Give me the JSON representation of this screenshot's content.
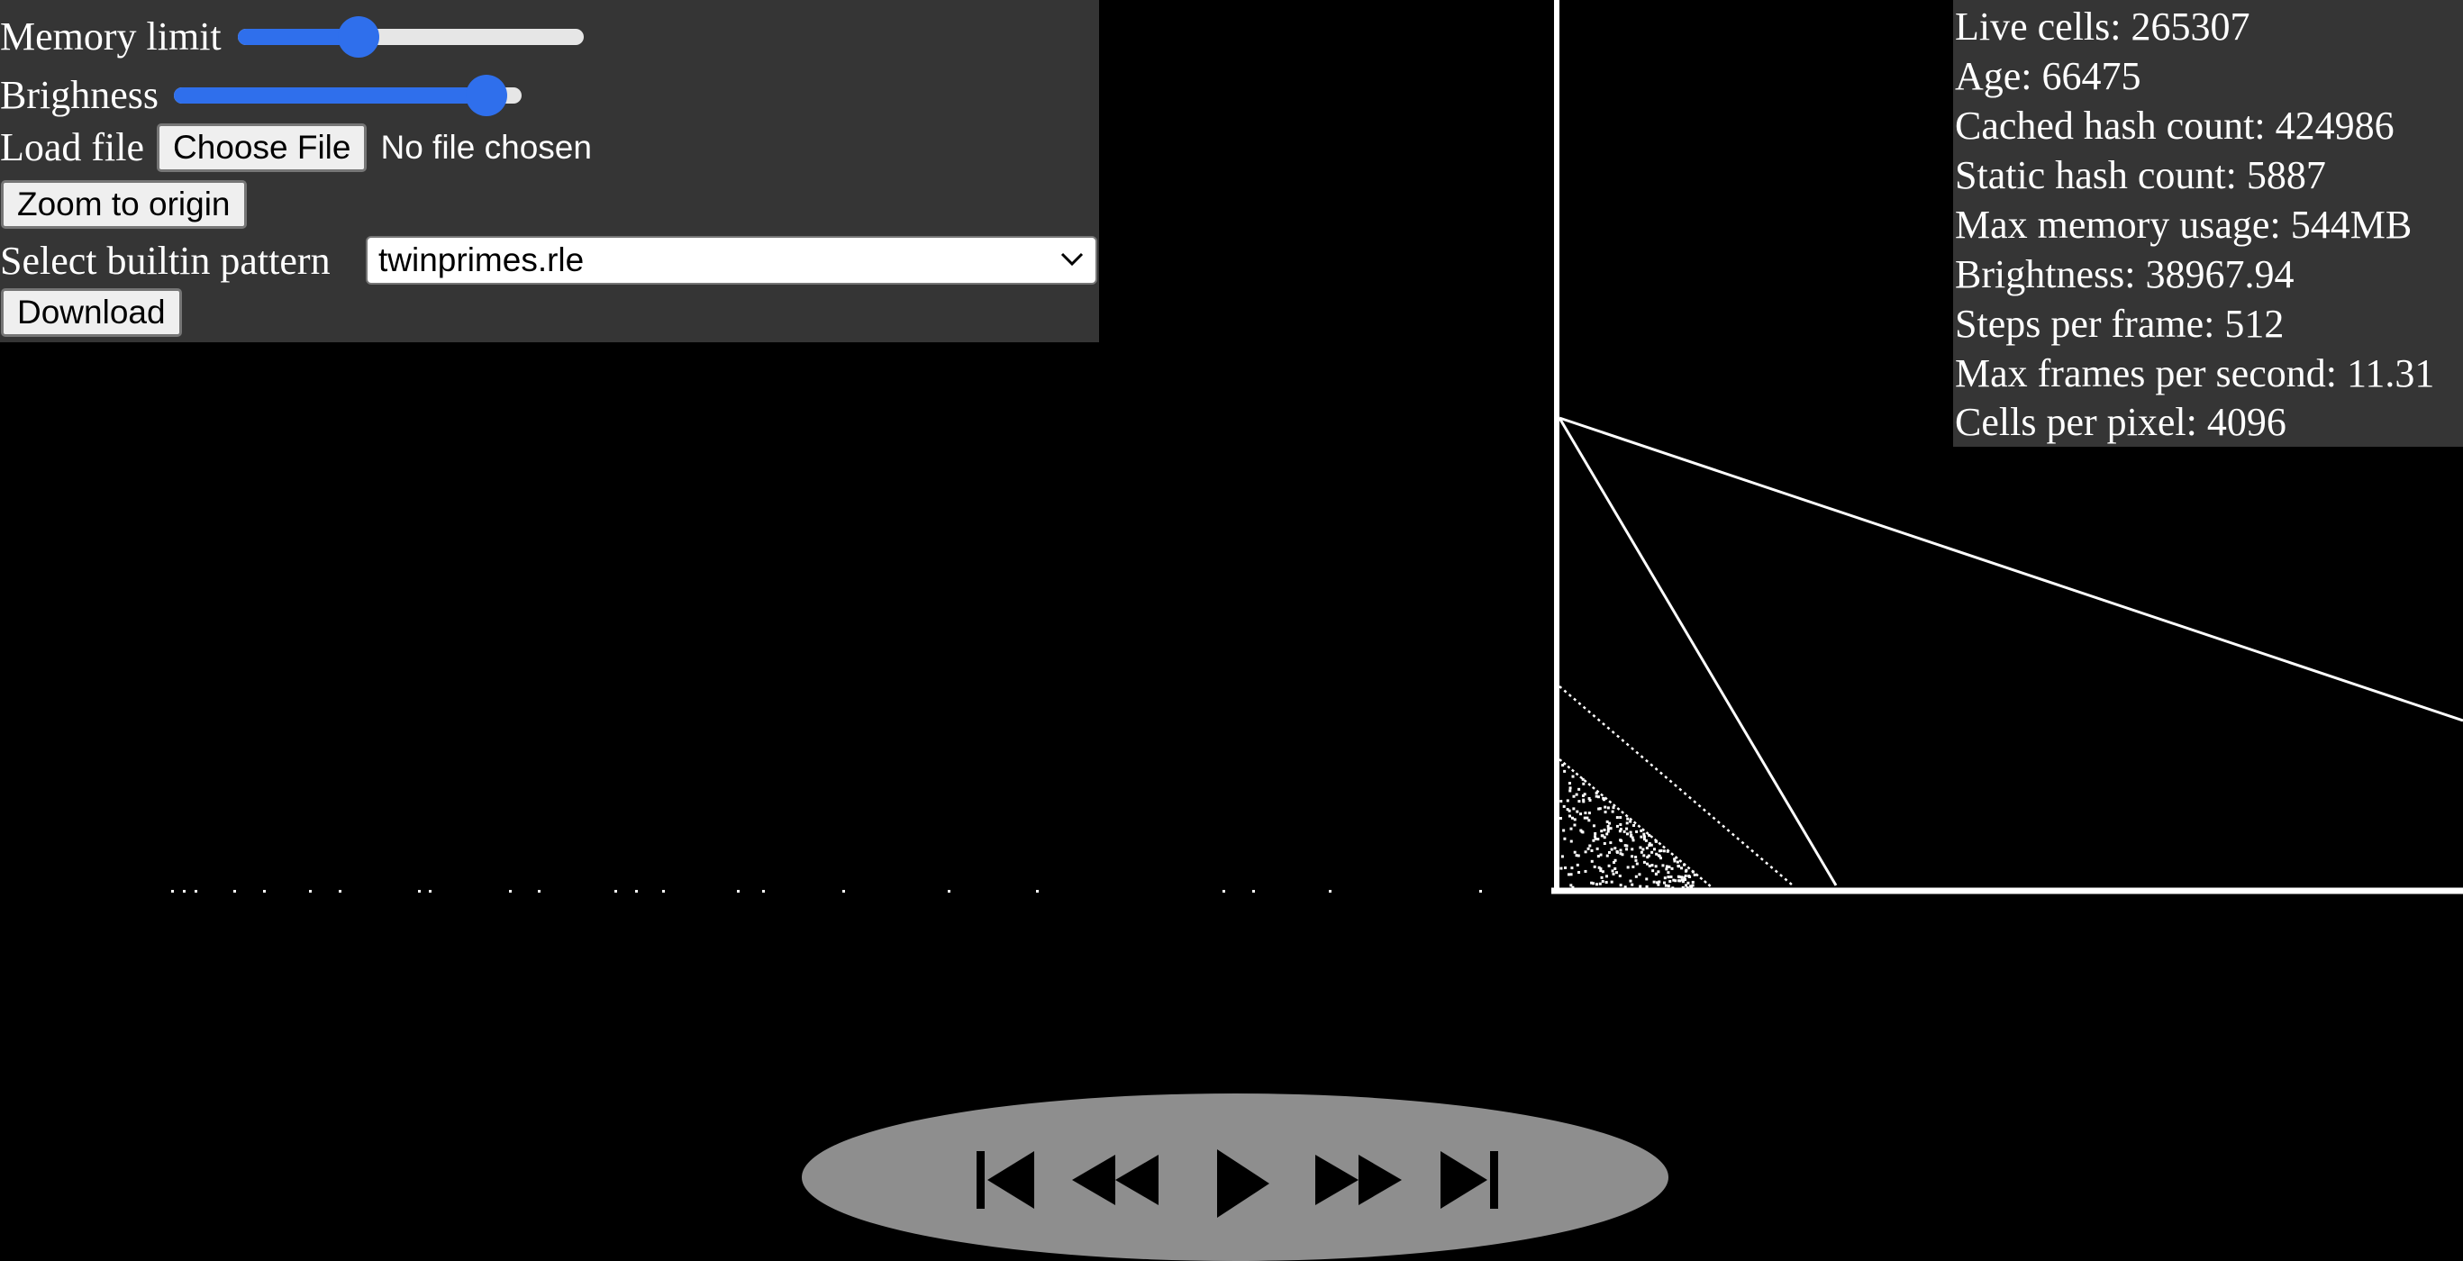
{
  "controls": {
    "memory_limit_label": "Memory limit",
    "memory_limit_value": 0.35,
    "brightness_label": "Brighness",
    "brightness_value": 0.9,
    "load_file_label": "Load file",
    "choose_file_label": "Choose File",
    "no_file_text": "No file chosen",
    "zoom_to_origin_label": "Zoom to origin",
    "builtin_pattern_label": "Select builtin pattern",
    "builtin_pattern_selected": "twinprimes.rle",
    "download_label": "Download",
    "accent_color": "#2f6fec"
  },
  "stats": {
    "live_cells": "Live cells: 265307",
    "age": "Age: 66475",
    "cached_hash_count": "Cached hash count: 424986",
    "static_hash_count": "Static hash count: 5887",
    "max_memory_usage": "Max memory usage: 544MB",
    "brightness": "Brightness: 38967.94",
    "steps_per_frame": "Steps per frame: 512",
    "max_frames_per_second": "Max frames per second: 11.31",
    "cells_per_pixel": "Cells per pixel: 4096"
  },
  "player": {
    "buttons": [
      {
        "name": "skip-to-start-icon"
      },
      {
        "name": "rewind-icon"
      },
      {
        "name": "play-icon"
      },
      {
        "name": "fast-forward-icon"
      },
      {
        "name": "skip-to-end-icon"
      }
    ]
  }
}
